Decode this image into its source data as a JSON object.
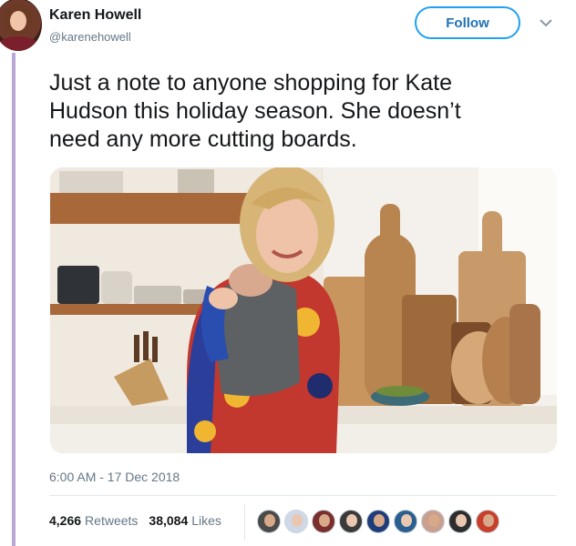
{
  "author": {
    "name": "Karen Howell",
    "handle": "@karenehowell"
  },
  "follow_label": "Follow",
  "tweet": {
    "line1": "Just a note to anyone shopping for Kate",
    "line2": "Hudson this holiday season. She doesn’t",
    "line3": "need any more cutting boards."
  },
  "timestamp": "6:00 AM - 17 Dec 2018",
  "stats": {
    "retweets_count": "4,266",
    "retweets_label": "Retweets",
    "likes_count": "38,084",
    "likes_label": "Likes"
  },
  "colors": {
    "accent": "#1da1f2",
    "thread_line": "#b9a7d4"
  },
  "liker_avatars": [
    "#4b4b4b",
    "#cfd8e6",
    "#7a2e2e",
    "#3a3a3a",
    "#1f3d7a",
    "#2b5f8f",
    "#c9a090",
    "#2e2e2e",
    "#c6402c"
  ]
}
